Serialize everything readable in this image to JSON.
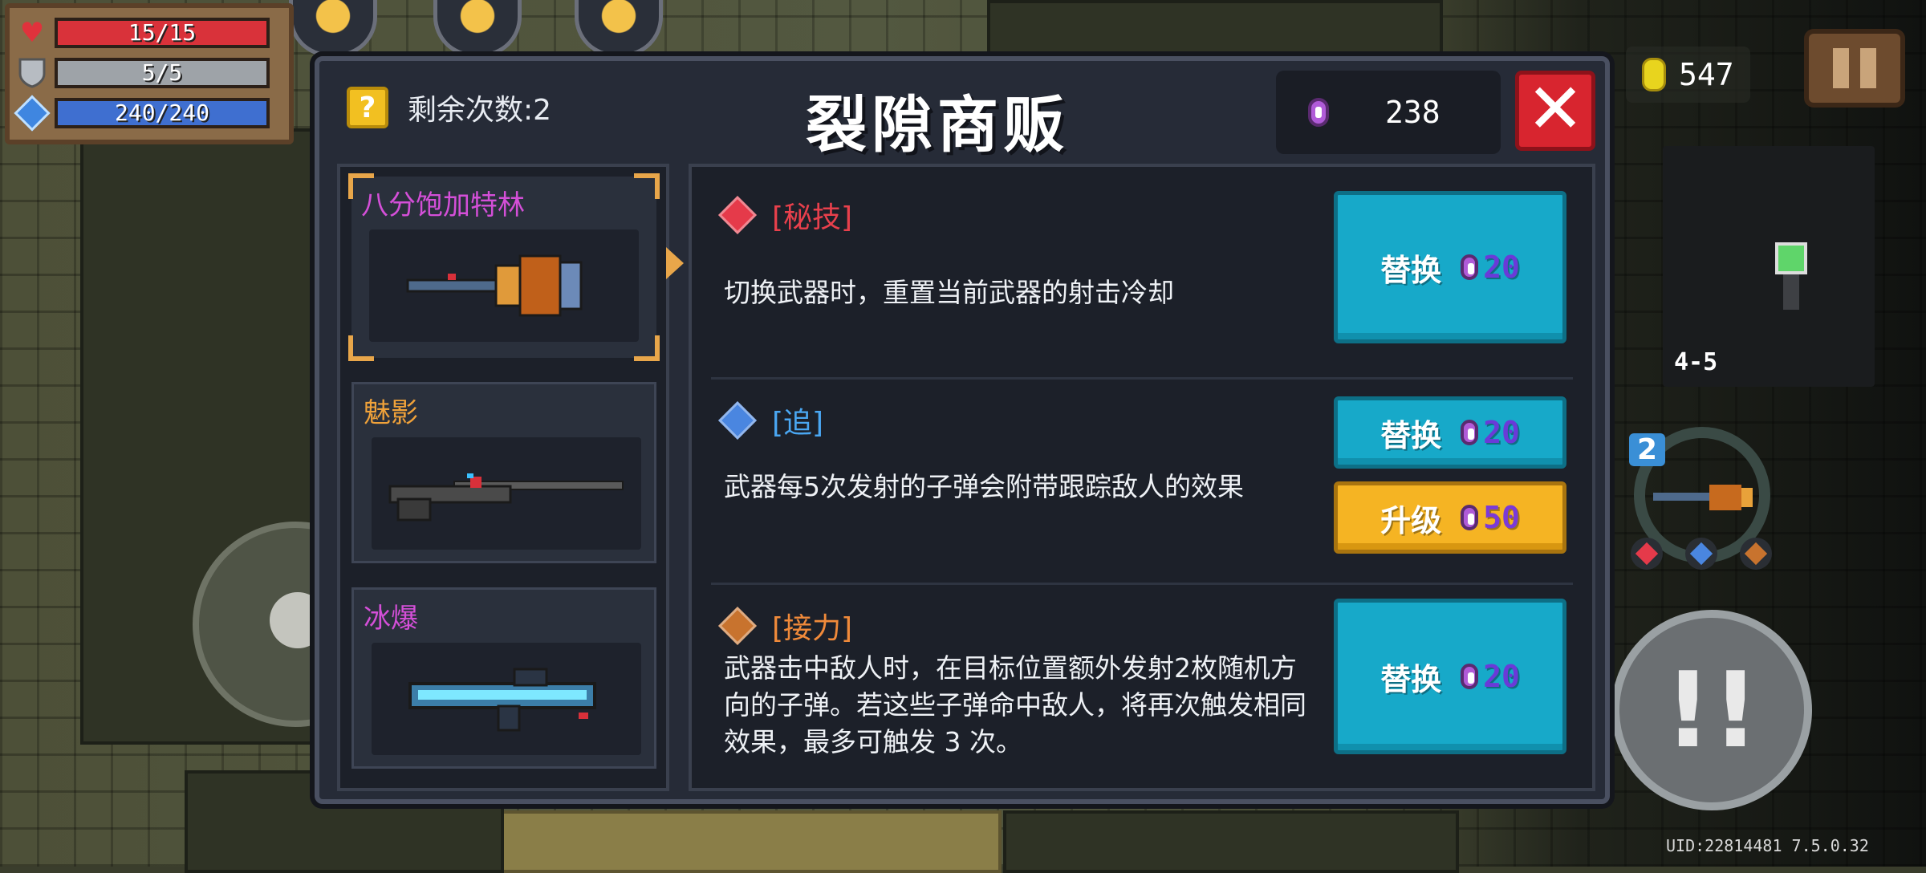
{
  "hud": {
    "hp": "15/15",
    "armor": "5/5",
    "energy": "240/240",
    "hp_fraction": 1,
    "armor_fraction": 1,
    "energy_fraction": 1,
    "coins": "547",
    "level": "4-5",
    "weapon_slot_count": "2",
    "uid": "UID:22814481 7.5.0.32"
  },
  "shop": {
    "remaining_label": "剩余次数:2",
    "title": "裂隙商贩",
    "gems": "238",
    "close_symbol": "✕",
    "question_symbol": "?",
    "weapons": [
      {
        "name": "八分饱加特林",
        "name_color": "#d44fd8",
        "selected": true
      },
      {
        "name": "魅影",
        "name_color": "#f0a23a",
        "selected": false
      },
      {
        "name": "冰爆",
        "name_color": "#d44fd8",
        "selected": false
      }
    ],
    "effects": [
      {
        "tag": "[秘技]",
        "tag_color": "#e8404c",
        "gem_color": "#e53a4a",
        "description": "切换武器时，重置当前武器的射击冷却",
        "actions": [
          {
            "label": "替换",
            "cost": "20",
            "style": "teal"
          }
        ]
      },
      {
        "tag": "[追]",
        "tag_color": "#4aa7f2",
        "gem_color": "#4a86e0",
        "description": "武器每5次发射的子弹会附带跟踪敌人的效果",
        "actions": [
          {
            "label": "替换",
            "cost": "20",
            "style": "teal"
          },
          {
            "label": "升级",
            "cost": "50",
            "style": "yellow"
          }
        ]
      },
      {
        "tag": "[接力]",
        "tag_color": "#f08a3a",
        "gem_color": "#c8732e",
        "description": "武器击中敌人时，在目标位置额外发射2枚随机方向的子弹。若这些子弹命中敌人，将再次触发相同效果，最多可触发 3 次。",
        "actions": [
          {
            "label": "替换",
            "cost": "20",
            "style": "teal"
          }
        ]
      }
    ]
  }
}
